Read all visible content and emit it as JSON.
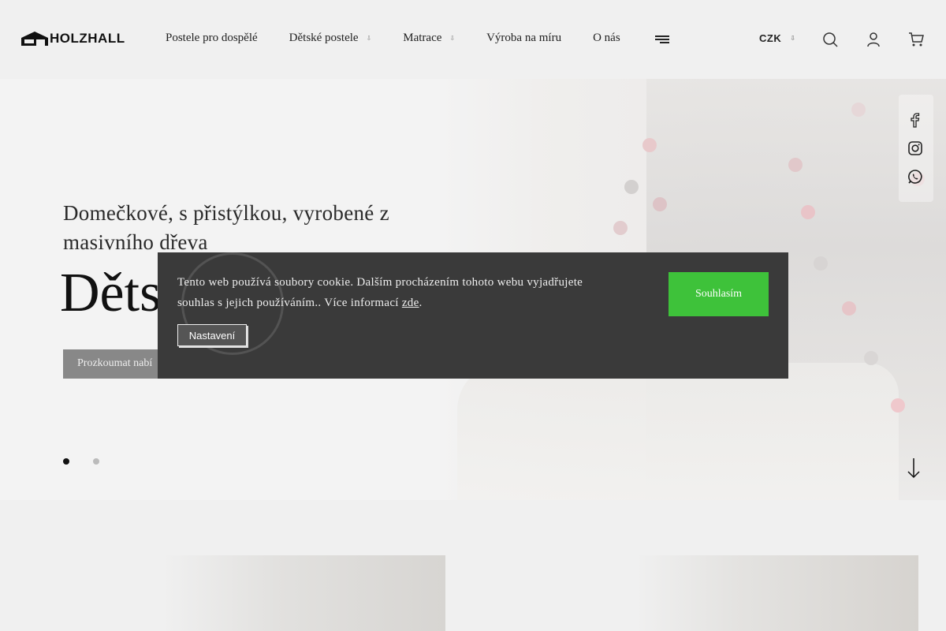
{
  "brand": {
    "name": "HOLZHALL"
  },
  "nav": {
    "items": [
      {
        "label": "Postele pro dospělé",
        "has_dropdown": false
      },
      {
        "label": "Dětské postele",
        "has_dropdown": true
      },
      {
        "label": "Matrace",
        "has_dropdown": true
      },
      {
        "label": "Výroba na míru",
        "has_dropdown": false
      },
      {
        "label": "O nás",
        "has_dropdown": false
      }
    ],
    "caret": "⇩",
    "more_icon": "menu-lines-icon"
  },
  "header": {
    "currency": "CZK",
    "icons": [
      "search-icon",
      "user-icon",
      "cart-icon"
    ]
  },
  "hero": {
    "subtitle": "Domečkové, s přistýlkou, vyrobené z masivního dřeva",
    "title": "Děts",
    "button_label": "Prozkoumat nabí",
    "slides": 2,
    "active_slide": 1,
    "social_icons": [
      "facebook-icon",
      "instagram-icon",
      "whatsapp-icon"
    ],
    "scroll_icon": "arrow-down-icon"
  },
  "cookie_banner": {
    "text": "Tento web používá soubory cookie. Dalším procházením tohoto webu vyjadřujete souhlas s jejich používáním.. Více informací ",
    "link_label": "zde",
    "text_end": ".",
    "accept_label": "Souhlasím",
    "settings_label": "Nastavení"
  },
  "colors": {
    "accept_green": "#3ec23a",
    "banner_bg": "#3a3a3a",
    "page_bg": "#f0f0f0"
  }
}
